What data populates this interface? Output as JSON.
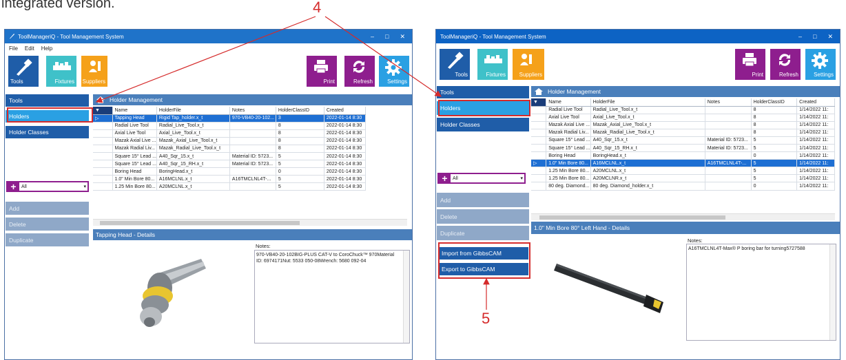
{
  "heading": "integrated version.",
  "callouts": {
    "four": "4",
    "five": "5"
  },
  "colors": {
    "title_left": "#1f73c9",
    "title_right": "#0d63c4",
    "nav": "#1f5da8",
    "nav_selected": "#2aa0e3",
    "accent_red": "#d52b2b",
    "purple": "#8e1e8e",
    "orange": "#f5a11a",
    "teal": "#3fc1c9",
    "section": "#4a7fbb"
  },
  "left": {
    "title": "ToolManageriQ - Tool Management System",
    "menu": [
      "File",
      "Edit",
      "Help"
    ],
    "window_controls": {
      "minimize": "–",
      "maximize": "□",
      "close": "✕"
    },
    "ribbon": {
      "tools": "Tools",
      "fixtures": "Fixtures",
      "suppliers": "Suppliers",
      "print": "Print",
      "refresh": "Refresh",
      "settings": "Settings"
    },
    "nav": {
      "tools": "Tools",
      "holders": "Holders",
      "holder_classes": "Holder Classes",
      "filter": "All",
      "add": "Add",
      "delete": "Delete",
      "duplicate": "Duplicate"
    },
    "section_title": "Holder Management",
    "columns": [
      "Name",
      "HolderFile",
      "Notes",
      "HolderClassID",
      "Created"
    ],
    "rows": [
      [
        "Tapping Head",
        "Rigid Tap_holder.x_t",
        "970-VB40-20-102...",
        "3",
        "2022-01-14 8:30"
      ],
      [
        "Radial Live Tool",
        "Radial_Live_Tool.x_t",
        "",
        "8",
        "2022-01-14 8:30"
      ],
      [
        "Axial Live Tool",
        "Axial_Live_Tool.x_t",
        "",
        "8",
        "2022-01-14 8:30"
      ],
      [
        "Mazak Axial Live ...",
        "Mazak_Axial_Live_Tool.x_t",
        "",
        "8",
        "2022-01-14 8:30"
      ],
      [
        "Mazak Radial Liv...",
        "Mazak_Radial_Live_Tool.x_t",
        "",
        "8",
        "2022-01-14 8:30"
      ],
      [
        "Square 15° Lead ...",
        "A40_Sqr_15.x_t",
        "Material ID: 5723...",
        "5",
        "2022-01-14 8:30"
      ],
      [
        "Square 15° Lead ...",
        "A40_Sqr_15_RH.x_t",
        "Material ID: 5723...",
        "5",
        "2022-01-14 8:30"
      ],
      [
        "Boring Head",
        "BoringHead.x_t",
        "",
        "0",
        "2022-01-14 8:30"
      ],
      [
        "1.0\" Min Bore 80...",
        "A16MCLNL.x_t",
        "A16TMCLNL4T-...",
        "5",
        "2022-01-14 8:30"
      ],
      [
        "1.25 Min Bore 80...",
        "A20MCLNL.x_t",
        "",
        "5",
        "2022-01-14 8:30"
      ]
    ],
    "details_title": "Tapping Head - Details",
    "notes_label": "Notes:",
    "notes_text": "970-VB40-20-102BIG-PLUS CAT-V to CoroChuck™ 970Material ID: 6974171Nut: 5533 050-08Wrench: 5680 092-04"
  },
  "right": {
    "title": "ToolManageriQ - Tool Management System",
    "window_controls": {
      "minimize": "–",
      "maximize": "□",
      "close": "✕"
    },
    "ribbon": {
      "tools": "Tools",
      "fixtures": "Fixtures",
      "suppliers": "Suppliers",
      "print": "Print",
      "refresh": "Refresh",
      "settings": "Settings"
    },
    "nav": {
      "tools": "Tools",
      "holders": "Holders",
      "holder_classes": "Holder Classes",
      "filter": "All",
      "add": "Add",
      "delete": "Delete",
      "duplicate": "Duplicate",
      "import": "Import from GibbsCAM",
      "export": "Export to GibbsCAM"
    },
    "section_title": "Holder Management",
    "columns": [
      "Name",
      "HolderFile",
      "Notes",
      "HolderClassID",
      "Created"
    ],
    "rows": [
      [
        "Radial Live Tool",
        "Radial_Live_Tool.x_t",
        "",
        "8",
        "1/14/2022 11:"
      ],
      [
        "Axial Live Tool",
        "Axial_Live_Tool.x_t",
        "",
        "8",
        "1/14/2022 11:"
      ],
      [
        "Mazak Axial Live ...",
        "Mazak_Axial_Live_Tool.x_t",
        "",
        "8",
        "1/14/2022 11:"
      ],
      [
        "Mazak Radial Liv...",
        "Mazak_Radial_Live_Tool.x_t",
        "",
        "8",
        "1/14/2022 11:"
      ],
      [
        "Square 15° Lead ...",
        "A40_Sqr_15.x_t",
        "Material ID: 5723...",
        "5",
        "1/14/2022 11:"
      ],
      [
        "Square 15° Lead ...",
        "A40_Sqr_15_RH.x_t",
        "Material ID: 5723...",
        "5",
        "1/14/2022 11:"
      ],
      [
        "Boring Head",
        "BoringHead.x_t",
        "",
        "0",
        "1/14/2022 11:"
      ],
      [
        "1.0\" Min Bore 80...",
        "A16MCLNL.x_t",
        "A16TMCLNL4T-...",
        "5",
        "1/14/2022 11:"
      ],
      [
        "1.25 Min Bore 80...",
        "A20MCLNL.x_t",
        "",
        "5",
        "1/14/2022 11:"
      ],
      [
        "1.25 Min Bore 80...",
        "A20MCLNR.x_t",
        "",
        "5",
        "1/14/2022 11:"
      ],
      [
        "80 deg. Diamond...",
        "80 deg. Diamond_holder.x_t",
        "",
        "0",
        "1/14/2022 11:"
      ]
    ],
    "details_title": "1.0\" Min Bore 80° Left Hand - Details",
    "notes_label": "Notes:",
    "notes_text": "A16TMCLNL4T-Max® P boring bar for turning5727588"
  }
}
